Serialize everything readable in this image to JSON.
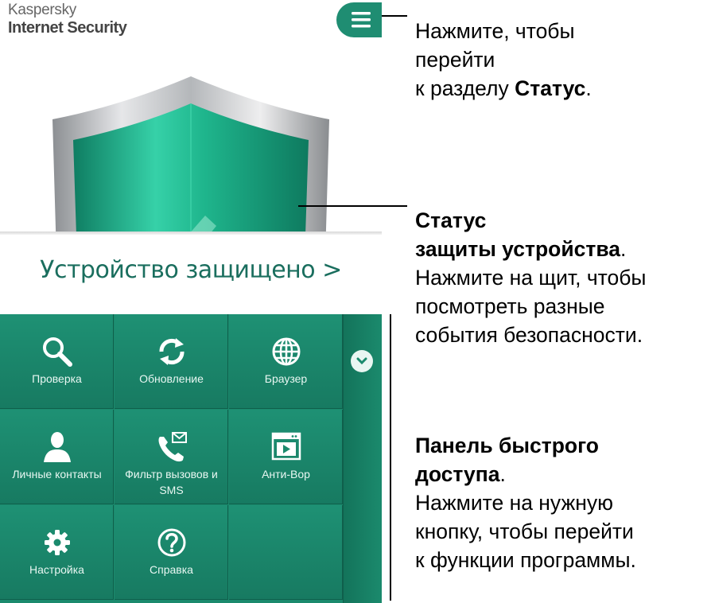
{
  "app": {
    "brand_line1": "Kaspersky",
    "brand_line2": "Internet Security",
    "status_text": "Устройство защищено >"
  },
  "tiles": [
    {
      "label": "Проверка",
      "icon": "search-icon"
    },
    {
      "label": "Обновление",
      "icon": "update-icon"
    },
    {
      "label": "Браузер",
      "icon": "globe-icon"
    },
    {
      "label": "Личные контакты",
      "icon": "person-icon"
    },
    {
      "label": "Фильтр вызовов и SMS",
      "icon": "phone-sms-icon"
    },
    {
      "label": "Анти-Вор",
      "icon": "antitheft-icon"
    },
    {
      "label": "Настройка",
      "icon": "gear-icon"
    },
    {
      "label": "Справка",
      "icon": "help-icon"
    }
  ],
  "annotations": {
    "menu": {
      "line1": "Нажмите, чтобы",
      "line2": "перейти",
      "line3_pre": "к разделу ",
      "line3_bold": "Статус",
      "line3_post": "."
    },
    "shield": {
      "bold1": "Статус",
      "bold2": "защиты устройства",
      "after2": ".",
      "line3": "Нажмите на щит, чтобы",
      "line4": "посмотреть разные",
      "line5": "события безопасности."
    },
    "panel": {
      "bold1": "Панель быстрого",
      "bold2": "доступа",
      "after2": ".",
      "line3": "Нажмите на нужную",
      "line4": "кнопку, чтобы перейти",
      "line5": "к функции программы."
    }
  },
  "colors": {
    "accent": "#1f8d72",
    "status_text": "#1a6e5e",
    "panel": "#1b8a6d"
  }
}
